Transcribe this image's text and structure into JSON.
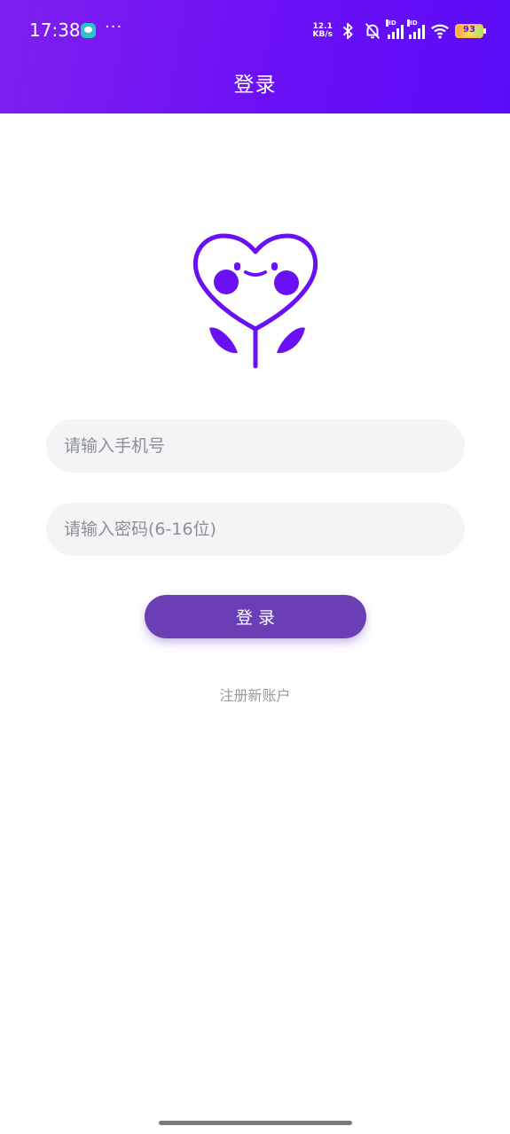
{
  "status_bar": {
    "time": "17:38",
    "dots": "···",
    "network_speed_value": "12.1",
    "network_speed_unit": "KB/s",
    "hd_label": "HD",
    "battery_level": "93"
  },
  "header": {
    "title": "登录",
    "gradient_start": "#7f1ff0",
    "gradient_end": "#5b0cf7"
  },
  "logo": {
    "icon": "heart-flower-icon",
    "color": "#6a10f5"
  },
  "form": {
    "phone_placeholder": "请输入手机号",
    "password_placeholder": "请输入密码(6-16位)",
    "login_label": "登录",
    "register_label": "注册新账户",
    "button_color": "#6a3fb6"
  }
}
